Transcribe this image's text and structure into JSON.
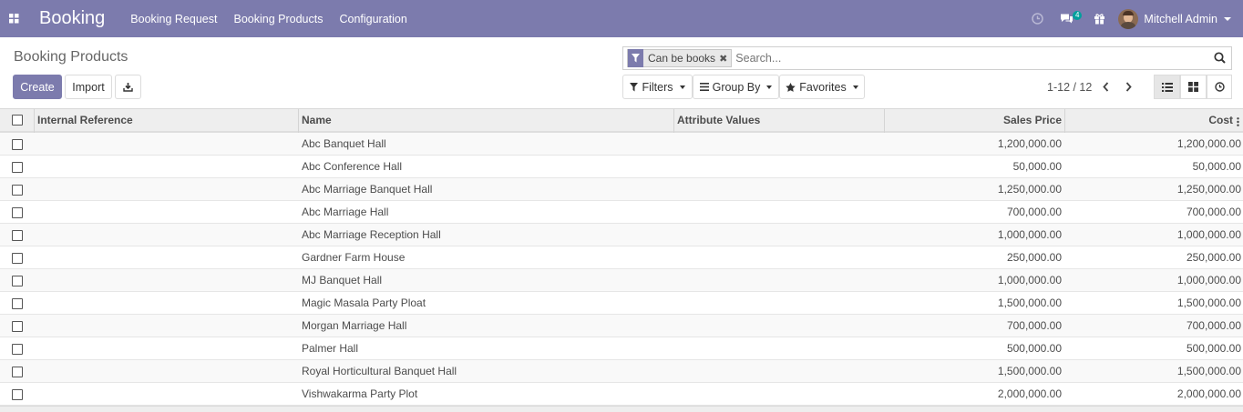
{
  "navbar": {
    "brand": "Booking",
    "menu": [
      "Booking Request",
      "Booking Products",
      "Configuration"
    ],
    "messages_count": "4",
    "user_name": "Mitchell Admin"
  },
  "control_panel": {
    "title": "Booking Products",
    "create_label": "Create",
    "import_label": "Import",
    "search": {
      "facet": "Can be books",
      "placeholder": "Search..."
    },
    "filters_label": "Filters",
    "group_by_label": "Group By",
    "favorites_label": "Favorites",
    "pager": "1-12 / 12"
  },
  "table": {
    "columns": [
      "Internal Reference",
      "Name",
      "Attribute Values",
      "Sales Price",
      "Cost"
    ],
    "rows": [
      {
        "ref": "",
        "name": "Abc Banquet Hall",
        "attrs": "",
        "price": "1,200,000.00",
        "cost": "1,200,000.00"
      },
      {
        "ref": "",
        "name": "Abc Conference Hall",
        "attrs": "",
        "price": "50,000.00",
        "cost": "50,000.00"
      },
      {
        "ref": "",
        "name": "Abc Marriage Banquet Hall",
        "attrs": "",
        "price": "1,250,000.00",
        "cost": "1,250,000.00"
      },
      {
        "ref": "",
        "name": "Abc Marriage Hall",
        "attrs": "",
        "price": "700,000.00",
        "cost": "700,000.00"
      },
      {
        "ref": "",
        "name": "Abc Marriage Reception Hall",
        "attrs": "",
        "price": "1,000,000.00",
        "cost": "1,000,000.00"
      },
      {
        "ref": "",
        "name": "Gardner Farm House",
        "attrs": "",
        "price": "250,000.00",
        "cost": "250,000.00"
      },
      {
        "ref": "",
        "name": "MJ Banquet Hall",
        "attrs": "",
        "price": "1,000,000.00",
        "cost": "1,000,000.00"
      },
      {
        "ref": "",
        "name": "Magic Masala Party Ploat",
        "attrs": "",
        "price": "1,500,000.00",
        "cost": "1,500,000.00"
      },
      {
        "ref": "",
        "name": "Morgan Marriage Hall",
        "attrs": "",
        "price": "700,000.00",
        "cost": "700,000.00"
      },
      {
        "ref": "",
        "name": "Palmer Hall",
        "attrs": "",
        "price": "500,000.00",
        "cost": "500,000.00"
      },
      {
        "ref": "",
        "name": "Royal Horticultural Banquet Hall",
        "attrs": "",
        "price": "1,500,000.00",
        "cost": "1,500,000.00"
      },
      {
        "ref": "",
        "name": "Vishwakarma Party Plot",
        "attrs": "",
        "price": "2,000,000.00",
        "cost": "2,000,000.00"
      }
    ]
  },
  "colors": {
    "primary": "#7c7bad",
    "badge": "#00a09d"
  }
}
